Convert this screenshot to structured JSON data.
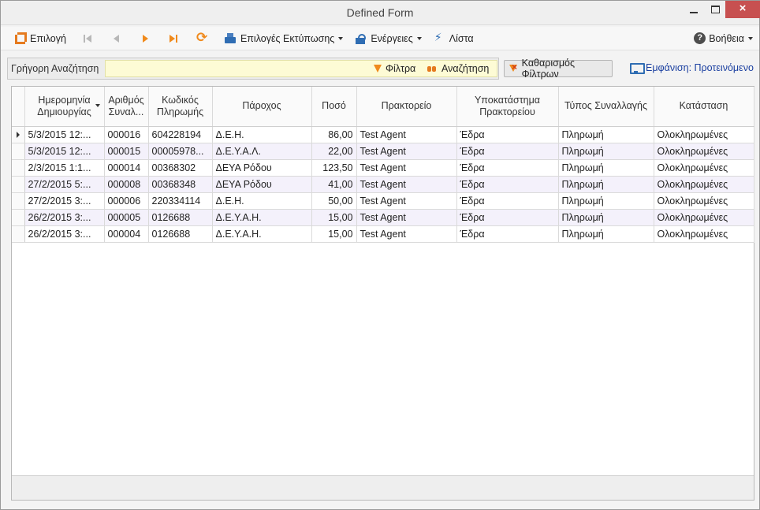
{
  "window": {
    "title": "Defined Form"
  },
  "toolbar": {
    "select_label": "Επιλογή",
    "print_label": "Επιλογές Εκτύπωσης",
    "actions_label": "Ενέργειες",
    "list_label": "Λίστα",
    "help_label": "Βοήθεια"
  },
  "search": {
    "label": "Γρήγορη Αναζήτηση",
    "value": "",
    "filters_label": "Φίλτρα",
    "search_label": "Αναζήτηση",
    "clear_label": "Καθαρισμός Φίλτρων"
  },
  "view": {
    "label": "Εμφάνιση: Προτεινόμενο"
  },
  "grid": {
    "headers": {
      "created": "Ημερομηνία Δημιουργίας",
      "txn_no": "Αριθμός Συναλ...",
      "pay_code": "Κωδικός Πληρωμής",
      "provider": "Πάροχος",
      "amount": "Ποσό",
      "agency": "Πρακτορείο",
      "branch": "Υποκατάστημα Πρακτορείου",
      "txn_type": "Τύπος Συναλλαγής",
      "status": "Κατάσταση"
    },
    "rows": [
      {
        "created": "5/3/2015 12:...",
        "txn_no": "000016",
        "pay_code": "604228194",
        "provider": "Δ.Ε.Η.",
        "amount": "86,00",
        "agency": "Test Agent",
        "branch": "Έδρα",
        "txn_type": "Πληρωμή",
        "status": "Ολοκληρωμένες"
      },
      {
        "created": "5/3/2015 12:...",
        "txn_no": "000015",
        "pay_code": "00005978...",
        "provider": "Δ.Ε.Υ.Α.Λ.",
        "amount": "22,00",
        "agency": "Test Agent",
        "branch": "Έδρα",
        "txn_type": "Πληρωμή",
        "status": "Ολοκληρωμένες"
      },
      {
        "created": "2/3/2015 1:1...",
        "txn_no": "000014",
        "pay_code": "00368302",
        "provider": "ΔΕΥΑ Ρόδου",
        "amount": "123,50",
        "agency": "Test Agent",
        "branch": "Έδρα",
        "txn_type": "Πληρωμή",
        "status": "Ολοκληρωμένες"
      },
      {
        "created": "27/2/2015 5:...",
        "txn_no": "000008",
        "pay_code": "00368348",
        "provider": "ΔΕΥΑ Ρόδου",
        "amount": "41,00",
        "agency": "Test Agent",
        "branch": "Έδρα",
        "txn_type": "Πληρωμή",
        "status": "Ολοκληρωμένες"
      },
      {
        "created": "27/2/2015 3:...",
        "txn_no": "000006",
        "pay_code": "220334114",
        "provider": "Δ.Ε.Η.",
        "amount": "50,00",
        "agency": "Test Agent",
        "branch": "Έδρα",
        "txn_type": "Πληρωμή",
        "status": "Ολοκληρωμένες"
      },
      {
        "created": "26/2/2015 3:...",
        "txn_no": "000005",
        "pay_code": "0126688",
        "provider": "Δ.Ε.Υ.Α.Η.",
        "amount": "15,00",
        "agency": "Test Agent",
        "branch": "Έδρα",
        "txn_type": "Πληρωμή",
        "status": "Ολοκληρωμένες"
      },
      {
        "created": "26/2/2015 3:...",
        "txn_no": "000004",
        "pay_code": "0126688",
        "provider": "Δ.Ε.Υ.Α.Η.",
        "amount": "15,00",
        "agency": "Test Agent",
        "branch": "Έδρα",
        "txn_type": "Πληρωμή",
        "status": "Ολοκληρωμένες"
      }
    ]
  }
}
